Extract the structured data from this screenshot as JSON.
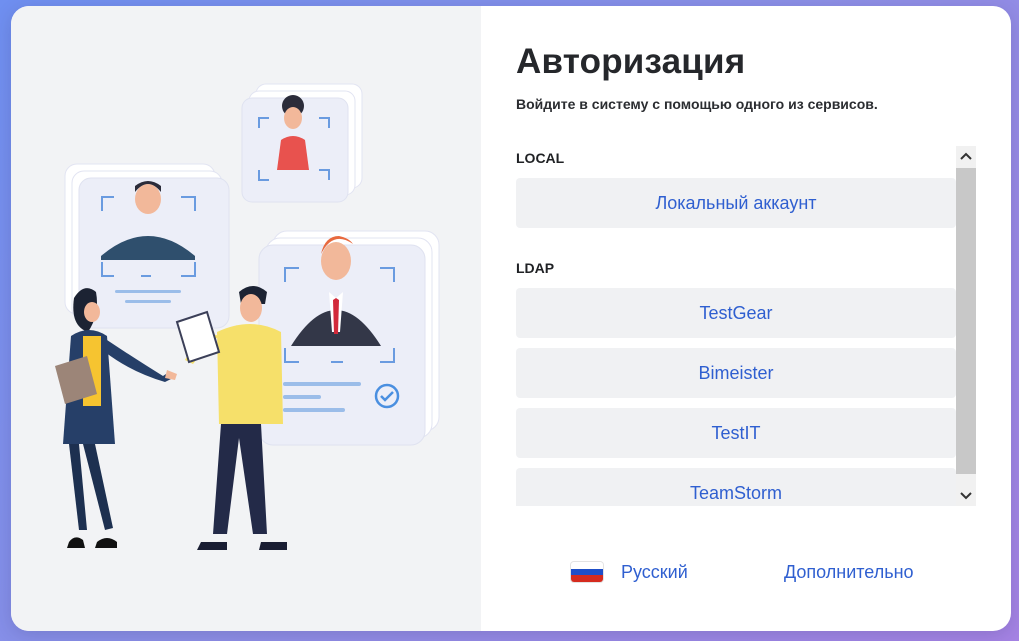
{
  "auth": {
    "title": "Авторизация",
    "subtitle": "Войдите в систему с помощью одного из сервисов."
  },
  "groups": [
    {
      "label": "LOCAL",
      "providers": [
        "Локальный аккаунт"
      ]
    },
    {
      "label": "LDAP",
      "providers": [
        "TestGear",
        "Bimeister",
        "TestIT",
        "TeamStorm"
      ]
    }
  ],
  "footer": {
    "language": "Русский",
    "more": "Дополнительно",
    "flag_icon": "russia-flag-icon"
  },
  "colors": {
    "accent": "#2f5fd0",
    "button_bg": "#f0f1f3",
    "left_panel_bg": "#f2f3f5",
    "background_gradient": [
      "#6f8ff0",
      "#a583e4"
    ]
  },
  "icons": [
    "chevron-up-icon",
    "chevron-down-icon",
    "check-circle-icon",
    "face-frame-icon"
  ]
}
